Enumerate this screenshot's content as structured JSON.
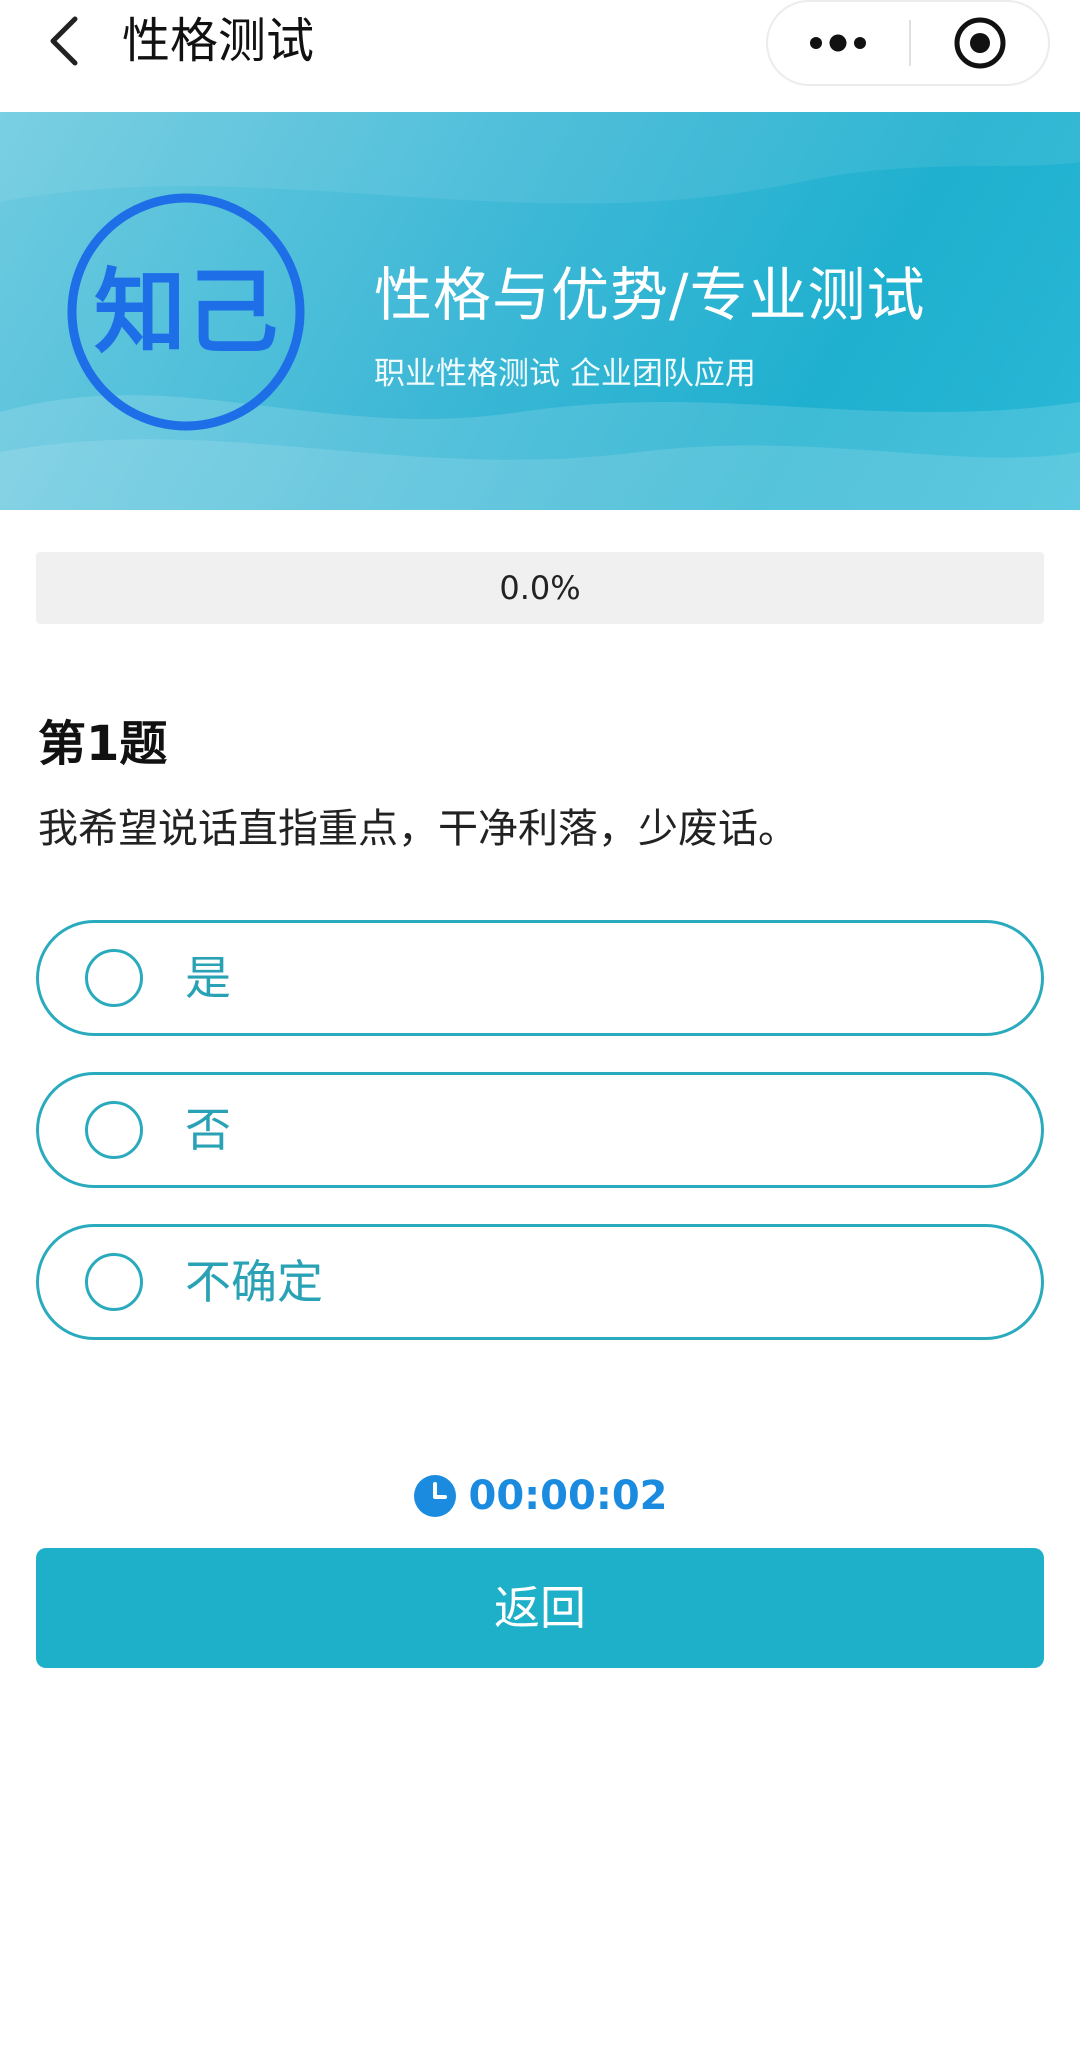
{
  "navbar": {
    "title": "性格测试",
    "back_icon": "chevron-left-icon",
    "more_icon": "more-dots-icon",
    "close_icon": "target-close-icon"
  },
  "banner": {
    "logo_text": "知己",
    "title": "性格与优势/专业测试",
    "subtitle": "职业性格测试 企业团队应用"
  },
  "progress": {
    "percent": 0.0,
    "label": "0.0%"
  },
  "question": {
    "number_label": "第1题",
    "text": "我希望说话直指重点，干净利落，少废话。",
    "options": [
      {
        "label": "是"
      },
      {
        "label": "否"
      },
      {
        "label": "不确定"
      }
    ]
  },
  "timer": {
    "icon": "clock-icon",
    "value": "00:00:02"
  },
  "actions": {
    "return_label": "返回"
  },
  "colors": {
    "accent": "#1fb0c9",
    "option_border": "#2aabbd",
    "timer": "#1b8be0",
    "logo": "#1e6ee8"
  }
}
